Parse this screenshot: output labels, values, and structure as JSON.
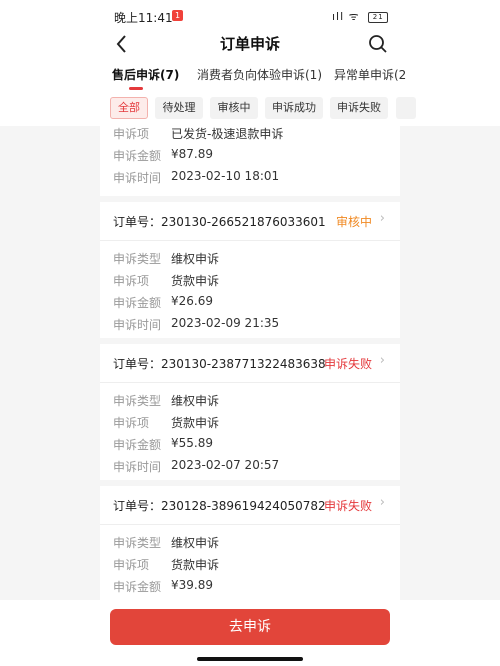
{
  "status_bar": {
    "time": "晚上11:41",
    "badge": "1",
    "signal": "ıll ᯤ",
    "battery": "21"
  },
  "nav": {
    "title": "订单申诉"
  },
  "tabs": [
    {
      "label": "售后申诉(7)"
    },
    {
      "label": "消费者负向体验申诉(1)"
    },
    {
      "label": "异常单申诉(2"
    }
  ],
  "filters": [
    "全部",
    "待处理",
    "审核中",
    "申诉成功",
    "申诉失败"
  ],
  "labels": {
    "type": "申诉类型",
    "item": "申诉项",
    "amount": "申诉金额",
    "time": "申诉时间"
  },
  "partial_card": {
    "item": "已发货-极速退款申诉",
    "amount": "¥87.89",
    "time": "2023-02-10 18:01"
  },
  "cards": [
    {
      "order_no": "订单号：230130-266521876033601",
      "status": "审核中",
      "status_color": "#f08a24",
      "type": "维权申诉",
      "item": "货款申诉",
      "amount": "¥26.69",
      "time": "2023-02-09 21:35"
    },
    {
      "order_no": "订单号：230130-238771322483638",
      "status": "申诉失败",
      "status_color": "#e4393c",
      "type": "维权申诉",
      "item": "货款申诉",
      "amount": "¥55.89",
      "time": "2023-02-07 20:57"
    },
    {
      "order_no": "订单号：230128-389619424050782",
      "status": "申诉失败",
      "status_color": "#e4393c",
      "type": "维权申诉",
      "item": "货款申诉",
      "amount": "¥39.89"
    }
  ],
  "bottom": {
    "button": "去申诉"
  }
}
